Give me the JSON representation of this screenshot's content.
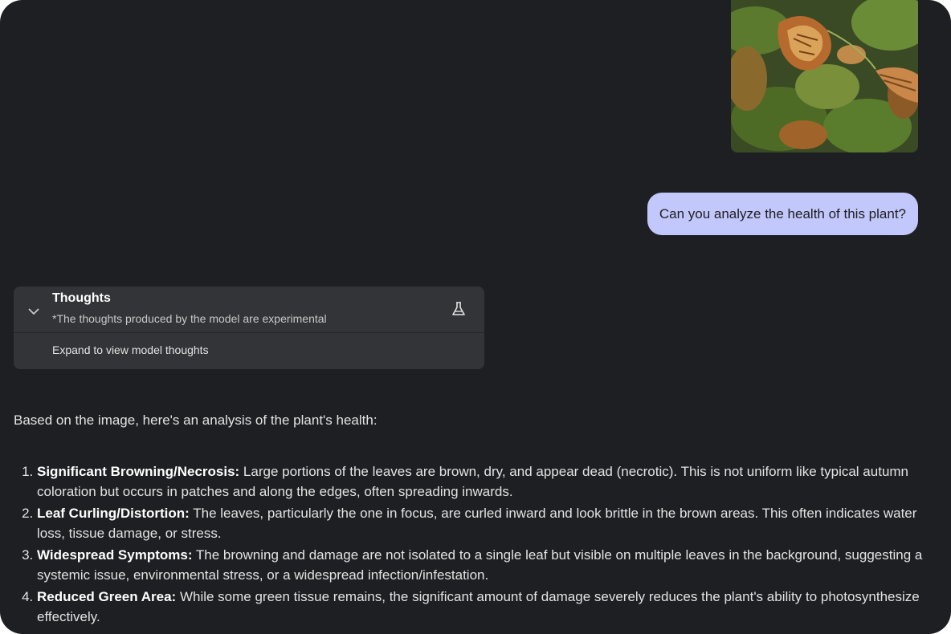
{
  "user_message": {
    "image_alt_icon": "plant-photo",
    "text": "Can you analyze the health of this plant?"
  },
  "thoughts": {
    "title": "Thoughts",
    "subtitle": "*The thoughts produced by the model are experimental",
    "expand_label": "Expand to view model thoughts",
    "toggle_icon": "chevron-down-icon",
    "badge_icon": "flask-icon"
  },
  "response": {
    "intro": "Based on the image, here's an analysis of the plant's health:",
    "points": [
      {
        "heading": "Significant Browning/Necrosis:",
        "body": " Large portions of the leaves are brown, dry, and appear dead (necrotic). This is not uniform like typical autumn coloration but occurs in patches and along the edges, often spreading inwards."
      },
      {
        "heading": "Leaf Curling/Distortion:",
        "body": " The leaves, particularly the one in focus, are curled inward and look brittle in the brown areas. This often indicates water loss, tissue damage, or stress."
      },
      {
        "heading": "Widespread Symptoms:",
        "body": " The browning and damage are not isolated to a single leaf but visible on multiple leaves in the background, suggesting a systemic issue, environmental stress, or a widespread infection/infestation."
      },
      {
        "heading": "Reduced Green Area:",
        "body": " While some green tissue remains, the significant amount of damage severely reduces the plant's ability to photosynthesize effectively."
      }
    ]
  },
  "colors": {
    "background": "#1e1f23",
    "user_bubble": "#c2c7fc",
    "panel": "#333438",
    "text": "#e3e3e3"
  }
}
